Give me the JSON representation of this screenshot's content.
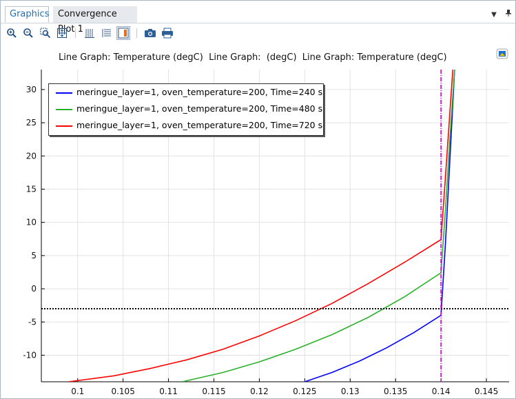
{
  "tabs": [
    {
      "label": "Graphics",
      "active": true
    },
    {
      "label": "Convergence Plot 1",
      "active": false
    }
  ],
  "toolbar": {
    "icons": [
      "zoom-in-icon",
      "zoom-out-icon",
      "zoom-box-icon",
      "zoom-extents-icon",
      "toggle-grid-icon",
      "toggle-axes-icon",
      "toggle-legend-icon",
      "camera-icon",
      "print-icon"
    ]
  },
  "plot_title": "Line Graph: Temperature (degC)  Line Graph:  (degC)  Line Graph: Temperature (degC)",
  "colors": {
    "blue": "#0000ff",
    "green": "#2ab12a",
    "red": "#ff0000",
    "marker": "#d000d0",
    "threshold": "#000000",
    "accent": "#1f6fb6"
  },
  "chart_data": {
    "type": "line",
    "xlim": [
      0.096,
      0.1475
    ],
    "ylim": [
      -14,
      33
    ],
    "x_ticks": [
      0.1,
      0.105,
      0.11,
      0.115,
      0.12,
      0.125,
      0.13,
      0.135,
      0.14,
      0.145
    ],
    "x_tick_labels": [
      "0.1",
      "0.105",
      "0.11",
      "0.115",
      "0.12",
      "0.125",
      "0.13",
      "0.135",
      "0.14",
      "0.145"
    ],
    "y_ticks": [
      -10,
      -5,
      0,
      5,
      10,
      15,
      20,
      25,
      30
    ],
    "y_tick_labels": [
      "-10",
      "-5",
      "0",
      "5",
      "10",
      "15",
      "20",
      "25",
      "30"
    ],
    "grid": true,
    "legend_position": "top-left",
    "series": [
      {
        "name": "meringue_layer=1, oven_temperature=200, Time=240 s",
        "color": "#0000ff",
        "x": [
          0.125,
          0.128,
          0.131,
          0.134,
          0.137,
          0.14,
          0.1405,
          0.141,
          0.1415
        ],
        "y": [
          -14,
          -12.6,
          -10.9,
          -8.9,
          -6.6,
          -4,
          7,
          20,
          33
        ]
      },
      {
        "name": "meringue_layer=1, oven_temperature=200, Time=480 s",
        "color": "#2ab12a",
        "x": [
          0.1115,
          0.116,
          0.12,
          0.124,
          0.128,
          0.132,
          0.136,
          0.14,
          0.1405,
          0.141,
          0.1415
        ],
        "y": [
          -14,
          -12.6,
          -11,
          -9.1,
          -6.9,
          -4.3,
          -1.2,
          2.4,
          12,
          23,
          33
        ]
      },
      {
        "name": "meringue_layer=1, oven_temperature=200, Time=720 s",
        "color": "#ff0000",
        "x": [
          0.099,
          0.104,
          0.108,
          0.112,
          0.116,
          0.12,
          0.124,
          0.128,
          0.132,
          0.136,
          0.14,
          0.1405,
          0.141,
          0.1413
        ],
        "y": [
          -14,
          -13.1,
          -12,
          -10.7,
          -9.1,
          -7.1,
          -4.8,
          -2.2,
          0.8,
          4,
          7.4,
          17,
          27,
          33
        ]
      }
    ],
    "reference_lines": [
      {
        "type": "horizontal",
        "y": -3,
        "style": "dotted",
        "color": "#000000"
      },
      {
        "type": "vertical",
        "x": 0.14,
        "style": "dash-dot",
        "color": "#d000d0"
      }
    ]
  }
}
